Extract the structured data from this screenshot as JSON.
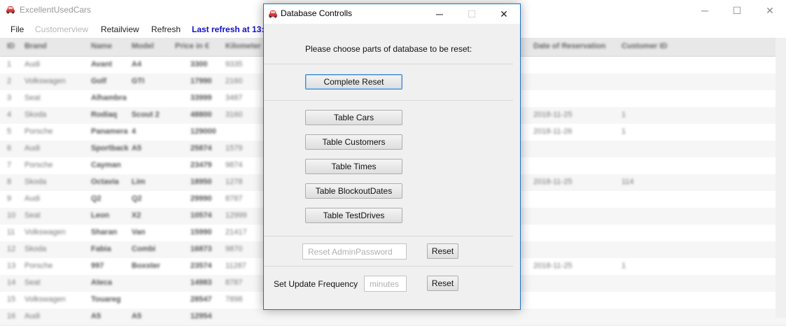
{
  "main_window": {
    "title": "ExcellentUsedCars",
    "controls": {
      "minimize": "─",
      "maximize": "☐",
      "close": "✕"
    },
    "menu": {
      "file": "File",
      "customerview": "Customerview",
      "retailview": "Retailview",
      "refresh": "Refresh",
      "last_refresh": "Last refresh at 13:"
    }
  },
  "table": {
    "headers": [
      "ID",
      "Brand",
      "Name",
      "Model",
      "Price in €",
      "Kilometer",
      "Date of Reservation",
      "Customer ID"
    ],
    "rows": [
      [
        "1",
        "Audi",
        "Avant",
        "A4",
        "3300",
        "9335",
        "",
        ""
      ],
      [
        "2",
        "Volkswagen",
        "Golf",
        "GTI",
        "17990",
        "2160",
        "",
        ""
      ],
      [
        "3",
        "Seat",
        "Alhambra",
        "",
        "33999",
        "3487",
        "",
        ""
      ],
      [
        "4",
        "Skoda",
        "Rodiaq",
        "Scout 2",
        "48800",
        "3160",
        "2018-11-25",
        "1"
      ],
      [
        "5",
        "Porsche",
        "Panamera",
        "4",
        "129000",
        "",
        "2018-11-26",
        "1"
      ],
      [
        "6",
        "Audi",
        "Sportback",
        "A5",
        "25874",
        "1579",
        "",
        ""
      ],
      [
        "7",
        "Porsche",
        "Cayman",
        "",
        "23479",
        "9874",
        "",
        ""
      ],
      [
        "8",
        "Skoda",
        "Octavia",
        "Lim",
        "18950",
        "1278",
        "2018-11-25",
        "114"
      ],
      [
        "9",
        "Audi",
        "Q2",
        "Q2",
        "29990",
        "8787",
        "",
        ""
      ],
      [
        "10",
        "Seat",
        "Leon",
        "X2",
        "10574",
        "12999",
        "",
        ""
      ],
      [
        "11",
        "Volkswagen",
        "Sharan",
        "Van",
        "15990",
        "21417",
        "",
        ""
      ],
      [
        "12",
        "Skoda",
        "Fabia",
        "Combi",
        "16873",
        "9870",
        "",
        ""
      ],
      [
        "13",
        "Porsche",
        "997",
        "Boxster",
        "23574",
        "11287",
        "2018-11-25",
        "1"
      ],
      [
        "14",
        "Seat",
        "Ateca",
        "",
        "14983",
        "8787",
        "",
        ""
      ],
      [
        "15",
        "Volkswagen",
        "Touareg",
        "",
        "28547",
        "7898",
        "",
        ""
      ],
      [
        "16",
        "Audi",
        "A5",
        "A5",
        "12954",
        "",
        "",
        ""
      ]
    ]
  },
  "dialog": {
    "title": "Database Controlls",
    "prompt": "Please choose parts of database to be reset:",
    "complete_reset": "Complete Reset",
    "table_buttons": [
      "Table Cars",
      "Table Customers",
      "Table Times",
      "Table BlockoutDates",
      "Table TestDrives"
    ],
    "admin_password_placeholder": "Reset AdminPassword",
    "reset_password_button": "Reset",
    "update_frequency_label": "Set Update Frequency",
    "update_frequency_placeholder": "minutes",
    "reset_frequency_button": "Reset"
  },
  "colors": {
    "status_text": "#1010d0",
    "dialog_border": "#1a73c8",
    "focused_button_border": "#3c8ad7"
  }
}
